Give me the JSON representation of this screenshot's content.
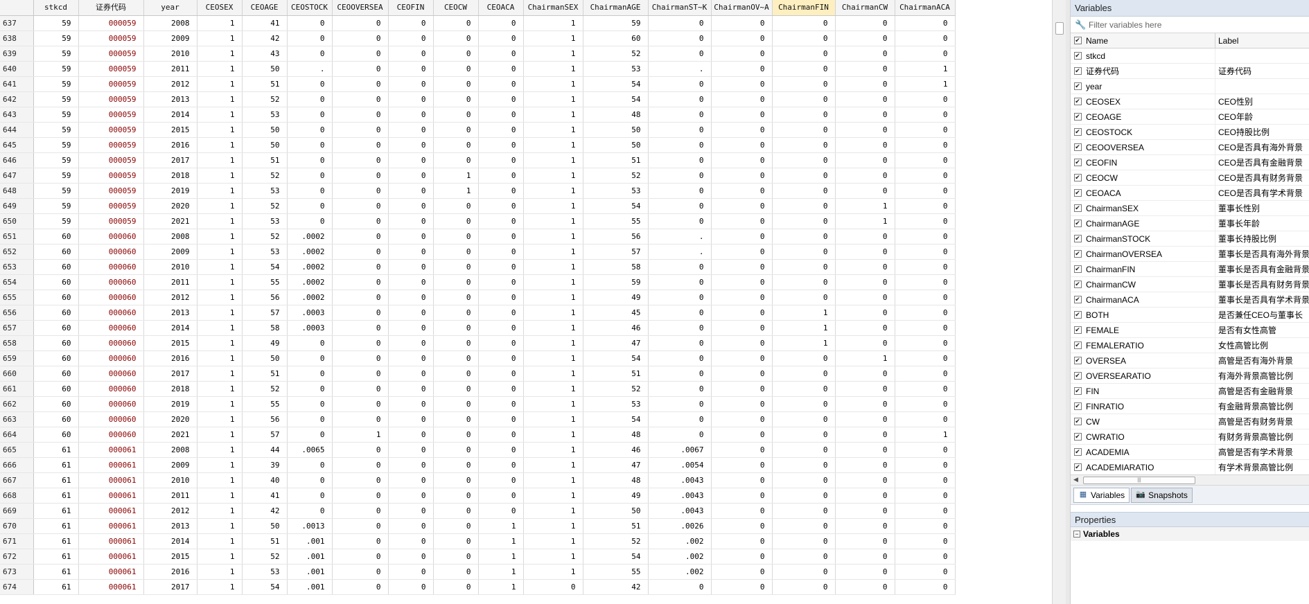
{
  "grid": {
    "columns": [
      {
        "key": "stkcd",
        "label": "stkcd"
      },
      {
        "key": "code",
        "label": "证券代码"
      },
      {
        "key": "year",
        "label": "year"
      },
      {
        "key": "CEOSEX",
        "label": "CEOSEX"
      },
      {
        "key": "CEOAGE",
        "label": "CEOAGE"
      },
      {
        "key": "CEOSTOCK",
        "label": "CEOSTOCK"
      },
      {
        "key": "CEOOVERSEA",
        "label": "CEOOVERSEA"
      },
      {
        "key": "CEOFIN",
        "label": "CEOFIN"
      },
      {
        "key": "CEOCW",
        "label": "CEOCW"
      },
      {
        "key": "CEOACA",
        "label": "CEOACA"
      },
      {
        "key": "ChairmanSEX",
        "label": "ChairmanSEX"
      },
      {
        "key": "ChairmanAGE",
        "label": "ChairmanAGE"
      },
      {
        "key": "ChairmanSTK",
        "label": "ChairmanST~K"
      },
      {
        "key": "ChairmanOVA",
        "label": "ChairmanOV~A"
      },
      {
        "key": "ChairmanFIN",
        "label": "ChairmanFIN"
      },
      {
        "key": "ChairmanCW",
        "label": "ChairmanCW"
      },
      {
        "key": "ChairmanACA",
        "label": "ChairmanACA"
      }
    ],
    "highlighted_column": "ChairmanFIN",
    "rows": [
      [
        "637",
        "59",
        "000059",
        "2008",
        "1",
        "41",
        "0",
        "0",
        "0",
        "0",
        "0",
        "1",
        "59",
        "0",
        "0",
        "0",
        "0",
        "0"
      ],
      [
        "638",
        "59",
        "000059",
        "2009",
        "1",
        "42",
        "0",
        "0",
        "0",
        "0",
        "0",
        "1",
        "60",
        "0",
        "0",
        "0",
        "0",
        "0"
      ],
      [
        "639",
        "59",
        "000059",
        "2010",
        "1",
        "43",
        "0",
        "0",
        "0",
        "0",
        "0",
        "1",
        "52",
        "0",
        "0",
        "0",
        "0",
        "0"
      ],
      [
        "640",
        "59",
        "000059",
        "2011",
        "1",
        "50",
        ".",
        "0",
        "0",
        "0",
        "0",
        "1",
        "53",
        ".",
        "0",
        "0",
        "0",
        "1"
      ],
      [
        "641",
        "59",
        "000059",
        "2012",
        "1",
        "51",
        "0",
        "0",
        "0",
        "0",
        "0",
        "1",
        "54",
        "0",
        "0",
        "0",
        "0",
        "1"
      ],
      [
        "642",
        "59",
        "000059",
        "2013",
        "1",
        "52",
        "0",
        "0",
        "0",
        "0",
        "0",
        "1",
        "54",
        "0",
        "0",
        "0",
        "0",
        "0"
      ],
      [
        "643",
        "59",
        "000059",
        "2014",
        "1",
        "53",
        "0",
        "0",
        "0",
        "0",
        "0",
        "1",
        "48",
        "0",
        "0",
        "0",
        "0",
        "0"
      ],
      [
        "644",
        "59",
        "000059",
        "2015",
        "1",
        "50",
        "0",
        "0",
        "0",
        "0",
        "0",
        "1",
        "50",
        "0",
        "0",
        "0",
        "0",
        "0"
      ],
      [
        "645",
        "59",
        "000059",
        "2016",
        "1",
        "50",
        "0",
        "0",
        "0",
        "0",
        "0",
        "1",
        "50",
        "0",
        "0",
        "0",
        "0",
        "0"
      ],
      [
        "646",
        "59",
        "000059",
        "2017",
        "1",
        "51",
        "0",
        "0",
        "0",
        "0",
        "0",
        "1",
        "51",
        "0",
        "0",
        "0",
        "0",
        "0"
      ],
      [
        "647",
        "59",
        "000059",
        "2018",
        "1",
        "52",
        "0",
        "0",
        "0",
        "1",
        "0",
        "1",
        "52",
        "0",
        "0",
        "0",
        "0",
        "0"
      ],
      [
        "648",
        "59",
        "000059",
        "2019",
        "1",
        "53",
        "0",
        "0",
        "0",
        "1",
        "0",
        "1",
        "53",
        "0",
        "0",
        "0",
        "0",
        "0"
      ],
      [
        "649",
        "59",
        "000059",
        "2020",
        "1",
        "52",
        "0",
        "0",
        "0",
        "0",
        "0",
        "1",
        "54",
        "0",
        "0",
        "0",
        "1",
        "0"
      ],
      [
        "650",
        "59",
        "000059",
        "2021",
        "1",
        "53",
        "0",
        "0",
        "0",
        "0",
        "0",
        "1",
        "55",
        "0",
        "0",
        "0",
        "1",
        "0"
      ],
      [
        "651",
        "60",
        "000060",
        "2008",
        "1",
        "52",
        ".0002",
        "0",
        "0",
        "0",
        "0",
        "1",
        "56",
        ".",
        "0",
        "0",
        "0",
        "0"
      ],
      [
        "652",
        "60",
        "000060",
        "2009",
        "1",
        "53",
        ".0002",
        "0",
        "0",
        "0",
        "0",
        "1",
        "57",
        ".",
        "0",
        "0",
        "0",
        "0"
      ],
      [
        "653",
        "60",
        "000060",
        "2010",
        "1",
        "54",
        ".0002",
        "0",
        "0",
        "0",
        "0",
        "1",
        "58",
        "0",
        "0",
        "0",
        "0",
        "0"
      ],
      [
        "654",
        "60",
        "000060",
        "2011",
        "1",
        "55",
        ".0002",
        "0",
        "0",
        "0",
        "0",
        "1",
        "59",
        "0",
        "0",
        "0",
        "0",
        "0"
      ],
      [
        "655",
        "60",
        "000060",
        "2012",
        "1",
        "56",
        ".0002",
        "0",
        "0",
        "0",
        "0",
        "1",
        "49",
        "0",
        "0",
        "0",
        "0",
        "0"
      ],
      [
        "656",
        "60",
        "000060",
        "2013",
        "1",
        "57",
        ".0003",
        "0",
        "0",
        "0",
        "0",
        "1",
        "45",
        "0",
        "0",
        "1",
        "0",
        "0"
      ],
      [
        "657",
        "60",
        "000060",
        "2014",
        "1",
        "58",
        ".0003",
        "0",
        "0",
        "0",
        "0",
        "1",
        "46",
        "0",
        "0",
        "1",
        "0",
        "0"
      ],
      [
        "658",
        "60",
        "000060",
        "2015",
        "1",
        "49",
        "0",
        "0",
        "0",
        "0",
        "0",
        "1",
        "47",
        "0",
        "0",
        "1",
        "0",
        "0"
      ],
      [
        "659",
        "60",
        "000060",
        "2016",
        "1",
        "50",
        "0",
        "0",
        "0",
        "0",
        "0",
        "1",
        "54",
        "0",
        "0",
        "0",
        "1",
        "0"
      ],
      [
        "660",
        "60",
        "000060",
        "2017",
        "1",
        "51",
        "0",
        "0",
        "0",
        "0",
        "0",
        "1",
        "51",
        "0",
        "0",
        "0",
        "0",
        "0"
      ],
      [
        "661",
        "60",
        "000060",
        "2018",
        "1",
        "52",
        "0",
        "0",
        "0",
        "0",
        "0",
        "1",
        "52",
        "0",
        "0",
        "0",
        "0",
        "0"
      ],
      [
        "662",
        "60",
        "000060",
        "2019",
        "1",
        "55",
        "0",
        "0",
        "0",
        "0",
        "0",
        "1",
        "53",
        "0",
        "0",
        "0",
        "0",
        "0"
      ],
      [
        "663",
        "60",
        "000060",
        "2020",
        "1",
        "56",
        "0",
        "0",
        "0",
        "0",
        "0",
        "1",
        "54",
        "0",
        "0",
        "0",
        "0",
        "0"
      ],
      [
        "664",
        "60",
        "000060",
        "2021",
        "1",
        "57",
        "0",
        "1",
        "0",
        "0",
        "0",
        "1",
        "48",
        "0",
        "0",
        "0",
        "0",
        "1"
      ],
      [
        "665",
        "61",
        "000061",
        "2008",
        "1",
        "44",
        ".0065",
        "0",
        "0",
        "0",
        "0",
        "1",
        "46",
        ".0067",
        "0",
        "0",
        "0",
        "0"
      ],
      [
        "666",
        "61",
        "000061",
        "2009",
        "1",
        "39",
        "0",
        "0",
        "0",
        "0",
        "0",
        "1",
        "47",
        ".0054",
        "0",
        "0",
        "0",
        "0"
      ],
      [
        "667",
        "61",
        "000061",
        "2010",
        "1",
        "40",
        "0",
        "0",
        "0",
        "0",
        "0",
        "1",
        "48",
        ".0043",
        "0",
        "0",
        "0",
        "0"
      ],
      [
        "668",
        "61",
        "000061",
        "2011",
        "1",
        "41",
        "0",
        "0",
        "0",
        "0",
        "0",
        "1",
        "49",
        ".0043",
        "0",
        "0",
        "0",
        "0"
      ],
      [
        "669",
        "61",
        "000061",
        "2012",
        "1",
        "42",
        "0",
        "0",
        "0",
        "0",
        "0",
        "1",
        "50",
        ".0043",
        "0",
        "0",
        "0",
        "0"
      ],
      [
        "670",
        "61",
        "000061",
        "2013",
        "1",
        "50",
        ".0013",
        "0",
        "0",
        "0",
        "1",
        "1",
        "51",
        ".0026",
        "0",
        "0",
        "0",
        "0"
      ],
      [
        "671",
        "61",
        "000061",
        "2014",
        "1",
        "51",
        ".001",
        "0",
        "0",
        "0",
        "1",
        "1",
        "52",
        ".002",
        "0",
        "0",
        "0",
        "0"
      ],
      [
        "672",
        "61",
        "000061",
        "2015",
        "1",
        "52",
        ".001",
        "0",
        "0",
        "0",
        "1",
        "1",
        "54",
        ".002",
        "0",
        "0",
        "0",
        "0"
      ],
      [
        "673",
        "61",
        "000061",
        "2016",
        "1",
        "53",
        ".001",
        "0",
        "0",
        "0",
        "1",
        "1",
        "55",
        ".002",
        "0",
        "0",
        "0",
        "0"
      ],
      [
        "674",
        "61",
        "000061",
        "2017",
        "1",
        "54",
        ".001",
        "0",
        "0",
        "0",
        "1",
        "0",
        "42",
        "0",
        "0",
        "0",
        "0",
        "0"
      ]
    ]
  },
  "variables_panel": {
    "title": "Variables",
    "filter_placeholder": "Filter variables here",
    "name_header": "Name",
    "label_header": "Label",
    "items": [
      {
        "name": "stkcd",
        "label": ""
      },
      {
        "name": "证券代码",
        "label": "证券代码"
      },
      {
        "name": "year",
        "label": ""
      },
      {
        "name": "CEOSEX",
        "label": "CEO性别"
      },
      {
        "name": "CEOAGE",
        "label": "CEO年龄"
      },
      {
        "name": "CEOSTOCK",
        "label": "CEO持股比例"
      },
      {
        "name": "CEOOVERSEA",
        "label": "CEO是否具有海外背景"
      },
      {
        "name": "CEOFIN",
        "label": "CEO是否具有金融背景"
      },
      {
        "name": "CEOCW",
        "label": "CEO是否具有财务背景"
      },
      {
        "name": "CEOACA",
        "label": "CEO是否具有学术背景"
      },
      {
        "name": "ChairmanSEX",
        "label": "董事长性别"
      },
      {
        "name": "ChairmanAGE",
        "label": "董事长年龄"
      },
      {
        "name": "ChairmanSTOCK",
        "label": "董事长持股比例"
      },
      {
        "name": "ChairmanOVERSEA",
        "label": "董事长是否具有海外背景"
      },
      {
        "name": "ChairmanFIN",
        "label": "董事长是否具有金融背景"
      },
      {
        "name": "ChairmanCW",
        "label": "董事长是否具有财务背景"
      },
      {
        "name": "ChairmanACA",
        "label": "董事长是否具有学术背景"
      },
      {
        "name": "BOTH",
        "label": "是否兼任CEO与董事长"
      },
      {
        "name": "FEMALE",
        "label": "是否有女性高管"
      },
      {
        "name": "FEMALERATIO",
        "label": "女性高管比例"
      },
      {
        "name": "OVERSEA",
        "label": "高管是否有海外背景"
      },
      {
        "name": "OVERSEARATIO",
        "label": "有海外背景高管比例"
      },
      {
        "name": "FIN",
        "label": "高管是否有金融背景"
      },
      {
        "name": "FINRATIO",
        "label": "有金融背景高管比例"
      },
      {
        "name": "CW",
        "label": "高管是否有财务背景"
      },
      {
        "name": "CWRATIO",
        "label": "有财务背景高管比例"
      },
      {
        "name": "ACADEMIA",
        "label": "高管是否有学术背景"
      },
      {
        "name": "ACADEMIARATIO",
        "label": "有学术背景高管比例"
      }
    ],
    "tabs": [
      {
        "label": "Variables",
        "icon": "variables-icon"
      },
      {
        "label": "Snapshots",
        "icon": "snapshots-icon"
      }
    ],
    "properties_title": "Properties",
    "properties_group": "Variables"
  }
}
